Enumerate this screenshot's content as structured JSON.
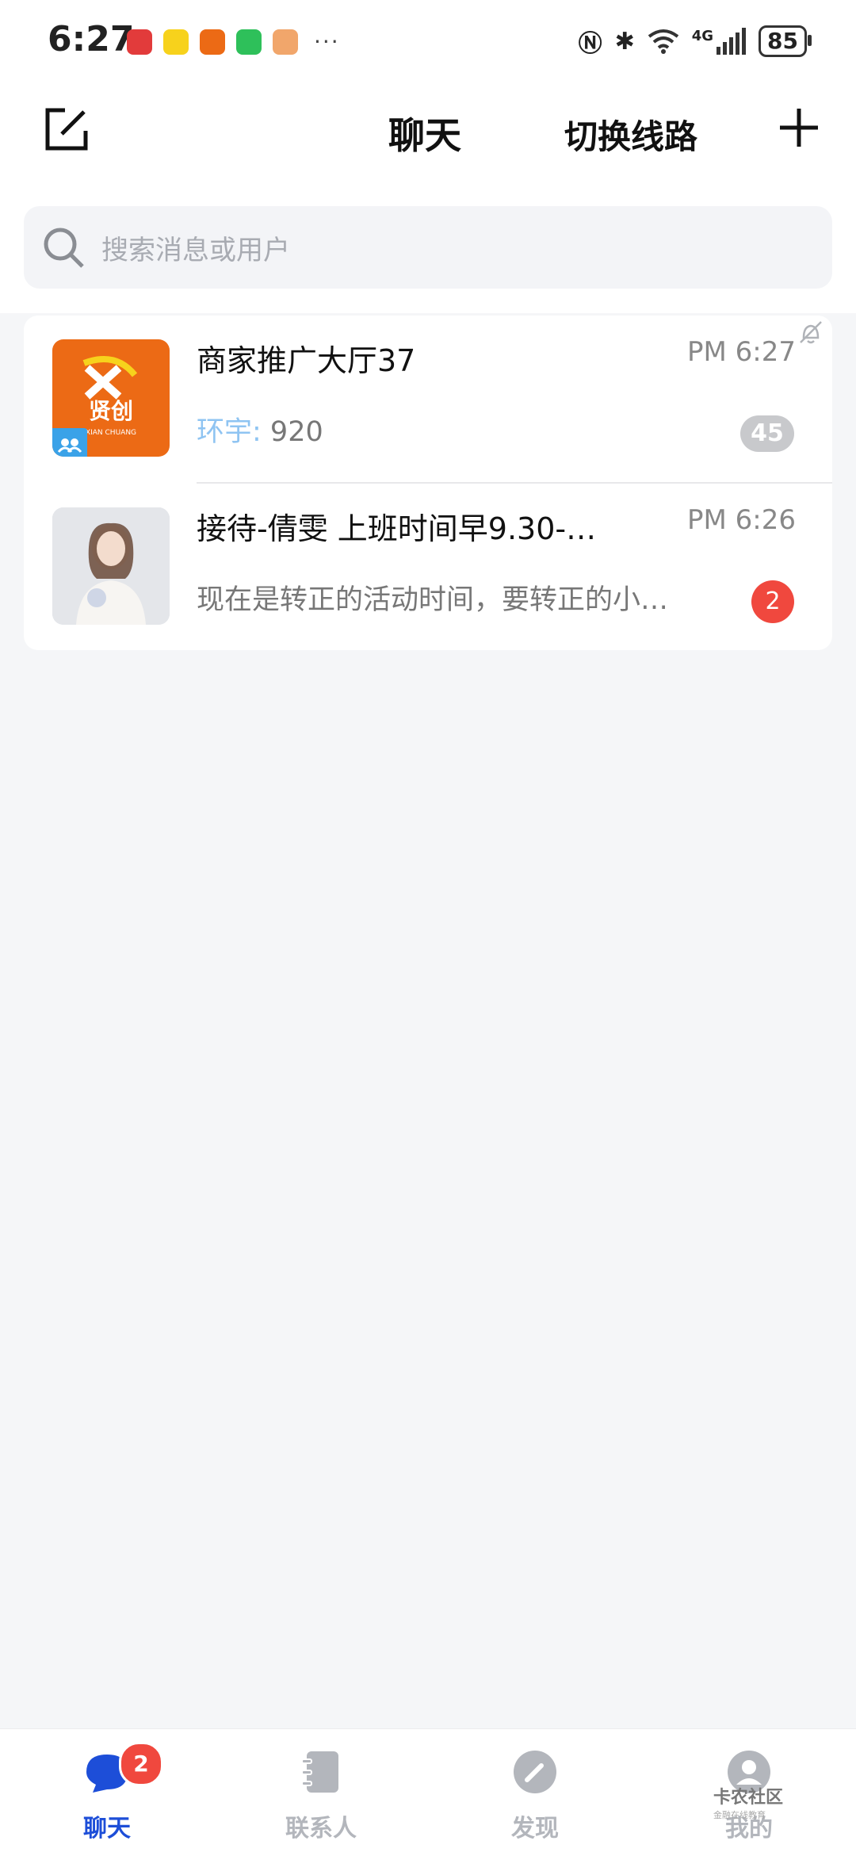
{
  "status_bar": {
    "time": "6:27",
    "network": "4G",
    "battery": "85",
    "more": "···"
  },
  "header": {
    "title": "聊天",
    "switch_route": "切换线路"
  },
  "search": {
    "placeholder": "搜索消息或用户"
  },
  "chats": [
    {
      "name": "商家推广大厅37",
      "time": "PM 6:27",
      "sender": "环宇:",
      "preview": " 920",
      "badge": "45",
      "muted": true,
      "logo_text": "贤创",
      "logo_sub": "XIAN CHUANG"
    },
    {
      "name": "接待-倩雯 上班时间早9.30-…",
      "time": "PM 6:26",
      "preview": "现在是转正的活动时间，要转正的小…",
      "badge": "2",
      "muted": false
    }
  ],
  "bottom_nav": {
    "items": [
      {
        "label": "聊天",
        "active": true,
        "badge": "2"
      },
      {
        "label": "联系人",
        "active": false
      },
      {
        "label": "发现",
        "active": false
      },
      {
        "label": "我的",
        "active": false
      }
    ]
  },
  "watermark": {
    "text": "卡农社区",
    "sub": "金融在线教育"
  },
  "colors": {
    "accent": "#1d4ed8",
    "badge_red": "#f0483e",
    "badge_grey": "#c8c9cc",
    "background": "#f5f6f8"
  }
}
